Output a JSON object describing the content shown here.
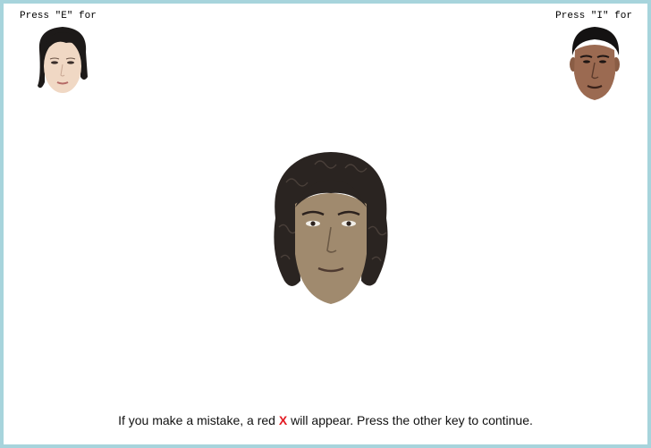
{
  "labels": {
    "left": "Press \"E\" for",
    "right": "Press \"I\" for"
  },
  "images": {
    "left_category_face": "face-female-light-skin",
    "right_category_face": "face-male-dark-skin",
    "stimulus_face": "face-male-curly-hair-tan-skin"
  },
  "instructions": {
    "before": "If you make a mistake, a red ",
    "mark": "X",
    "after": " will appear. Press the other key to continue."
  },
  "colors": {
    "frame_border": "#a7d4dc",
    "error_mark": "#e31b23"
  }
}
